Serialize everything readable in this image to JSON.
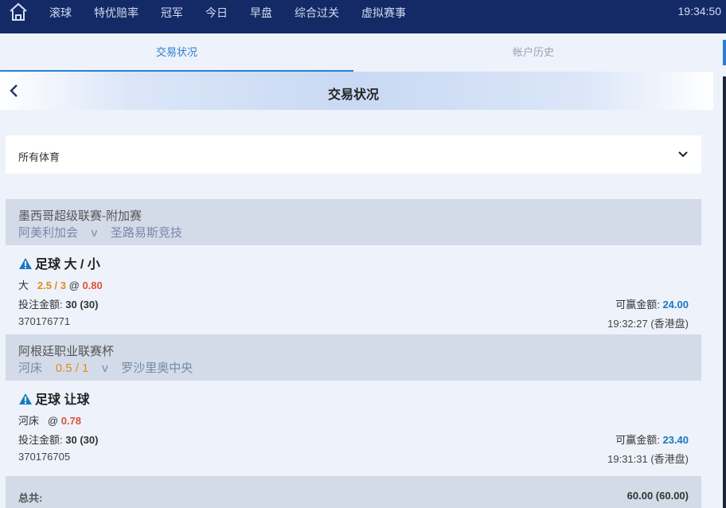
{
  "topnav": {
    "items": [
      "滚球",
      "特优赔率",
      "冠军",
      "今日",
      "早盘",
      "综合过关",
      "虚拟赛事"
    ],
    "clock": "19:34:50"
  },
  "tabs": {
    "active": "交易状况",
    "inactive": "帐户历史"
  },
  "header": {
    "title": "交易状况"
  },
  "filter": {
    "selected": "所有体育"
  },
  "bets": [
    {
      "league": "墨西哥超级联赛-附加赛",
      "home": "阿美利加会",
      "vs": "v",
      "handicap": "",
      "away": "圣路易斯竞技",
      "market": "足球 大 / 小",
      "selection": "大",
      "line": "2.5 / 3",
      "at": "@",
      "odds": "0.80",
      "stake_label": "投注金额:",
      "stake": "30 (30)",
      "win_label": "可赢金额:",
      "win": "24.00",
      "ref": "370176771",
      "time": "19:32:27 (香港盘)"
    },
    {
      "league": "阿根廷职业联赛杯",
      "home": "河床",
      "vs": "v",
      "handicap": "0.5 / 1",
      "away": "罗沙里奥中央",
      "market": "足球 让球",
      "selection": "河床",
      "line": "",
      "at": "@",
      "odds": "0.78",
      "stake_label": "投注金额:",
      "stake": "30 (30)",
      "win_label": "可赢金额:",
      "win": "23.40",
      "ref": "370176705",
      "time": "19:31:31 (香港盘)"
    }
  ],
  "total": {
    "label": "总共:",
    "value": "60.00 (60.00)"
  },
  "colors": {
    "nav": "#132a66",
    "accent": "#2a7fd4",
    "orange": "#e88a1c",
    "red": "#e0523a",
    "win_blue": "#1a78c2"
  },
  "icons": [
    "home-icon",
    "back-arrow-icon",
    "chevron-down-icon",
    "warning-icon"
  ]
}
